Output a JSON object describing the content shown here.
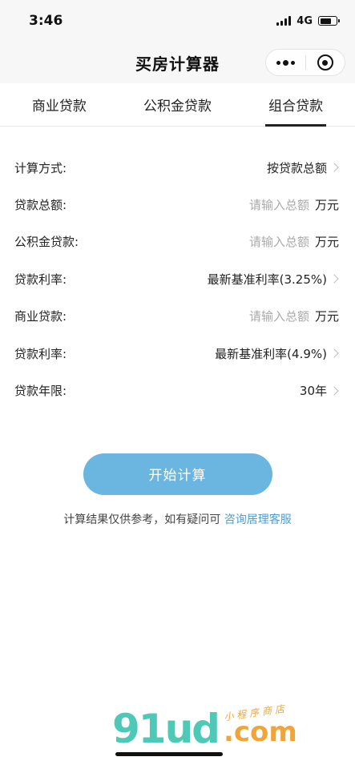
{
  "status_bar": {
    "time": "3:46",
    "network": "4G"
  },
  "nav": {
    "title": "买房计算器"
  },
  "tabs": [
    {
      "label": "商业贷款",
      "active": false
    },
    {
      "label": "公积金贷款",
      "active": false
    },
    {
      "label": "组合贷款",
      "active": true
    }
  ],
  "form": {
    "calc_method": {
      "label": "计算方式:",
      "value": "按贷款总额"
    },
    "loan_total": {
      "label": "贷款总额:",
      "placeholder": "请输入总额",
      "unit": "万元"
    },
    "provident_loan": {
      "label": "公积金贷款:",
      "placeholder": "请输入总额",
      "unit": "万元"
    },
    "provident_rate": {
      "label": "贷款利率:",
      "value": "最新基准利率(3.25%)"
    },
    "commercial_loan": {
      "label": "商业贷款:",
      "placeholder": "请输入总额",
      "unit": "万元"
    },
    "commercial_rate": {
      "label": "贷款利率:",
      "value": "最新基准利率(4.9%)"
    },
    "loan_term": {
      "label": "贷款年限:",
      "value": "30年"
    }
  },
  "actions": {
    "calculate_label": "开始计算"
  },
  "disclaimer": {
    "text": "计算结果仅供参考，如有疑问可 ",
    "link": "咨询居理客服"
  },
  "watermark": {
    "logo": "91ud",
    "tagline": "小程序商店",
    "domain": ".com"
  },
  "colors": {
    "button": "#6ab6e0",
    "link": "#4a9fd1",
    "watermark_green": "#4fc9b7",
    "watermark_orange": "#f0a53a"
  }
}
